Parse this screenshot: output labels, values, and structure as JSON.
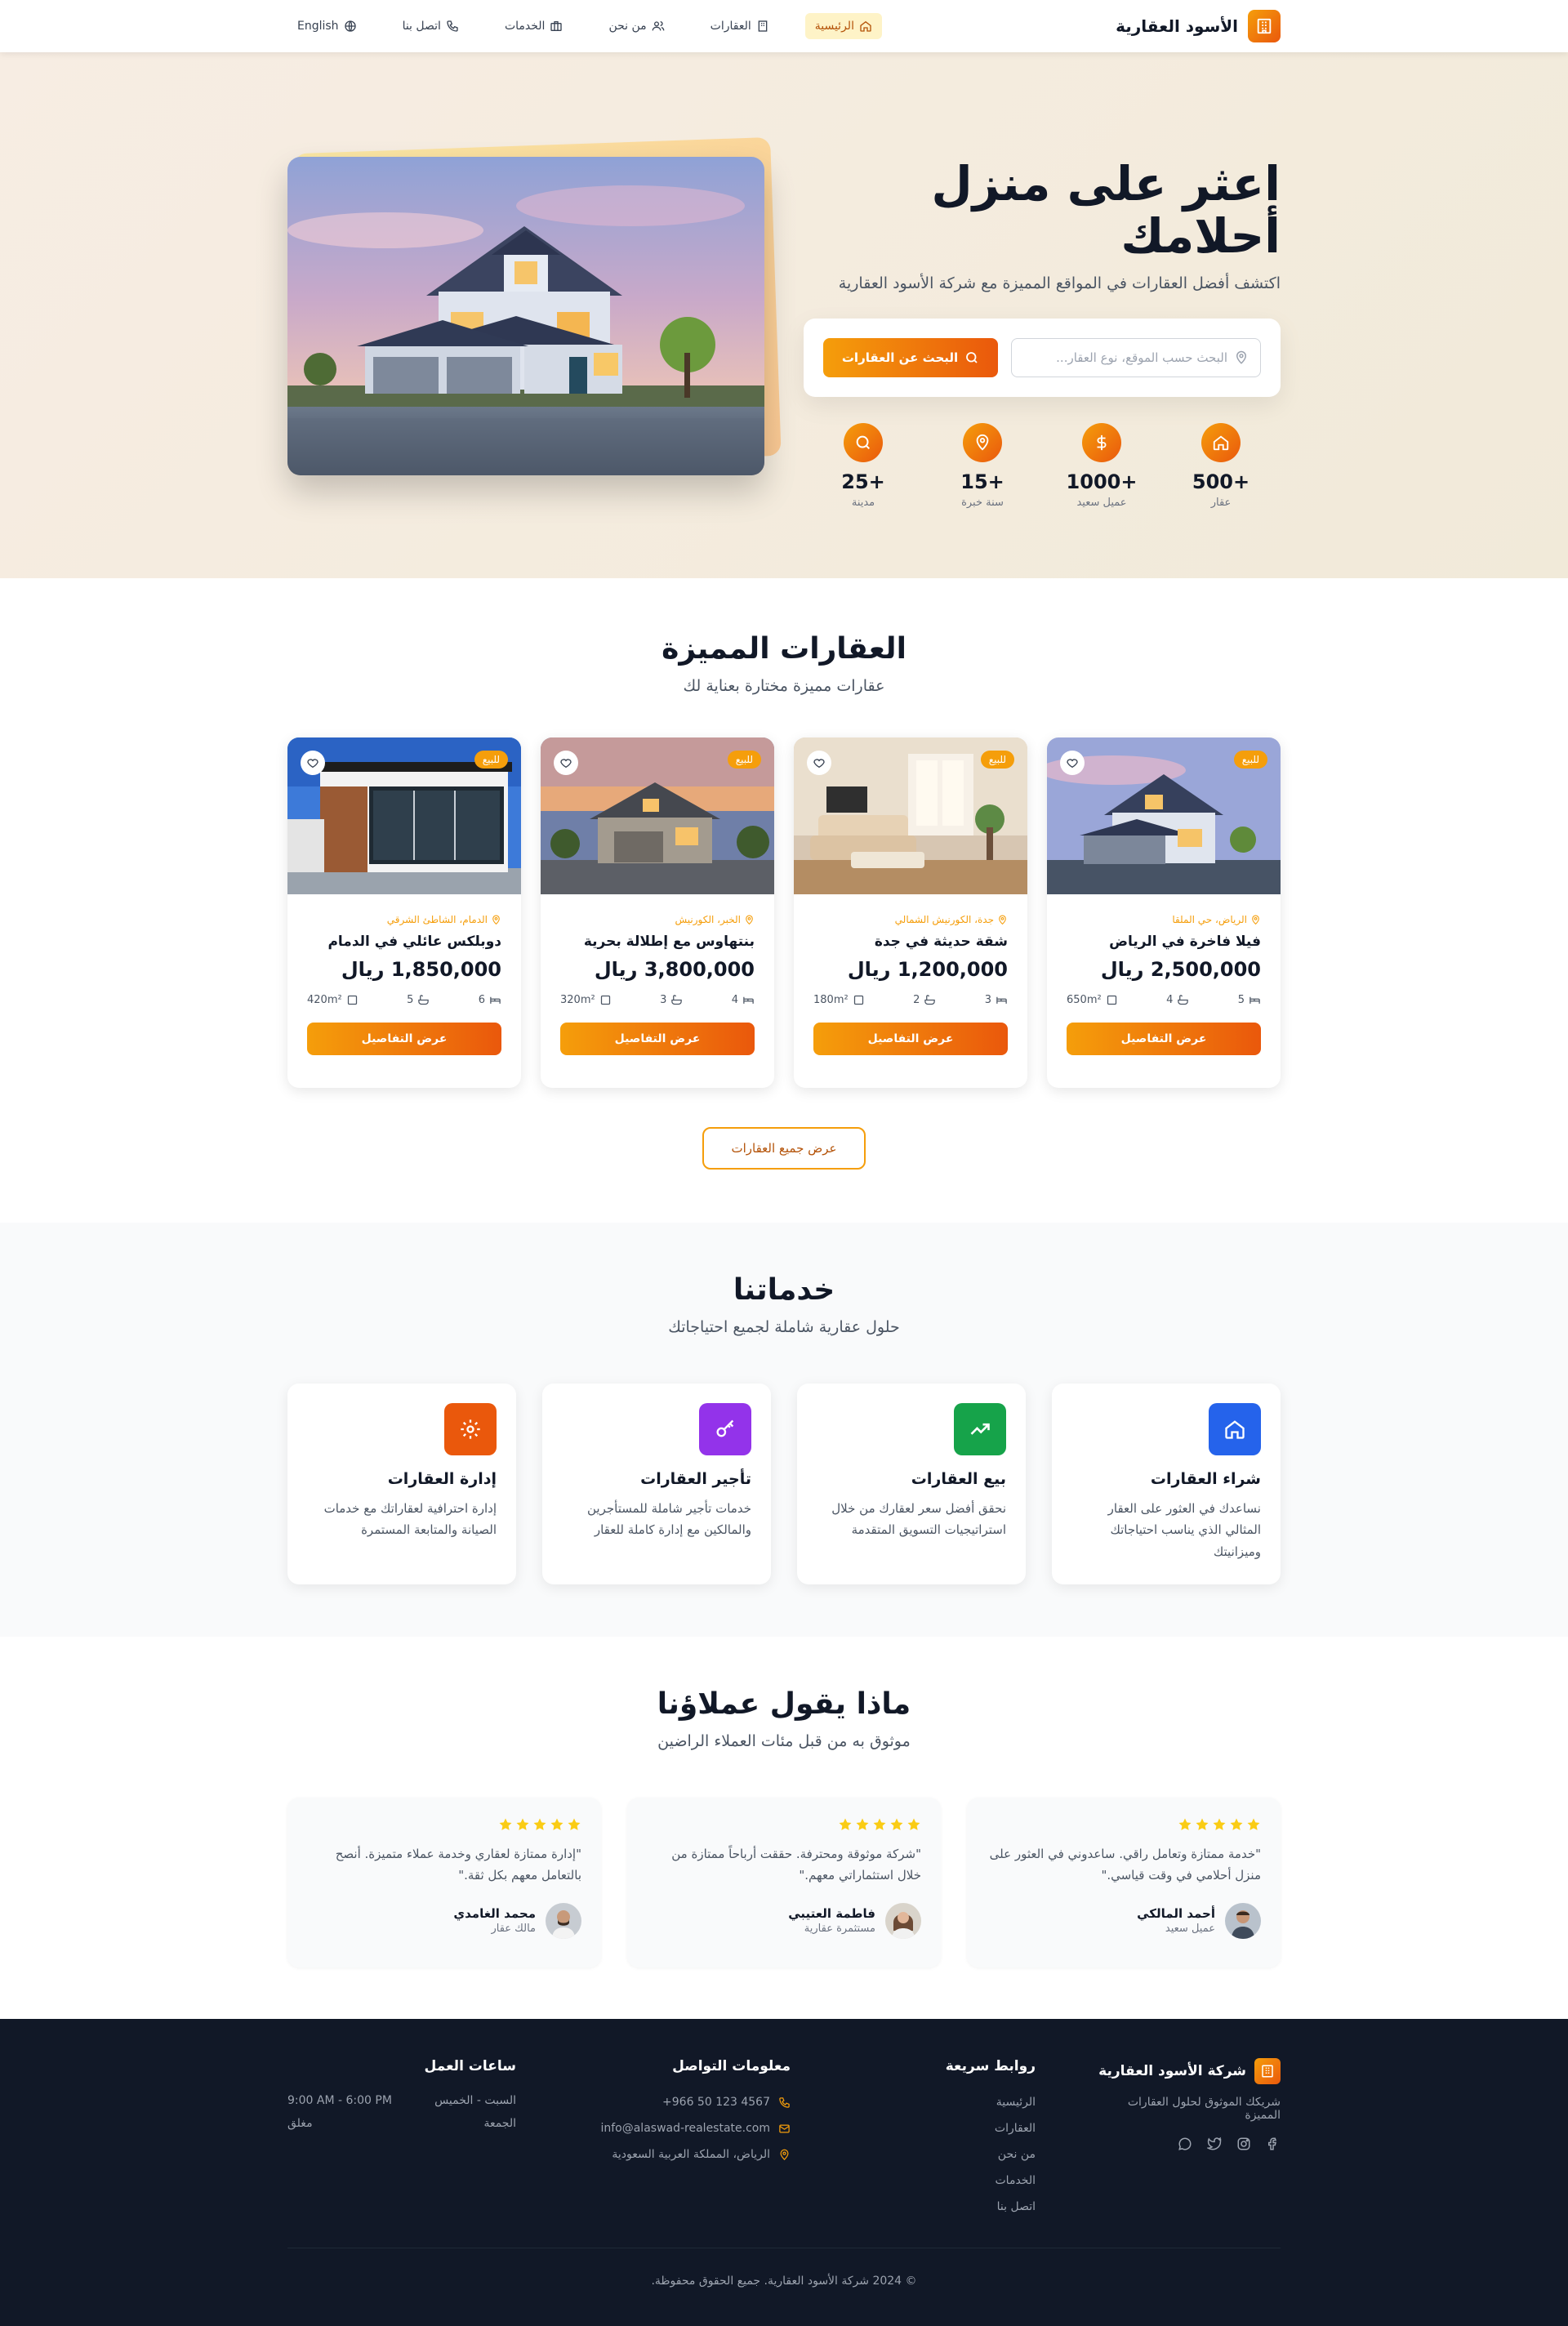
{
  "nav": {
    "brand": "الأسود العقارية",
    "items": [
      {
        "label": "الرئيسية"
      },
      {
        "label": "العقارات"
      },
      {
        "label": "من نحن"
      },
      {
        "label": "الخدمات"
      },
      {
        "label": "اتصل بنا"
      },
      {
        "label": "English"
      }
    ]
  },
  "hero": {
    "title": "اعثر على منزل أحلامك",
    "subtitle": "اكتشف أفضل العقارات في المواقع المميزة مع شركة الأسود العقارية",
    "search_placeholder": "البحث حسب الموقع، نوع العقار...",
    "search_button": "البحث عن العقارات",
    "stats": [
      {
        "num": "500+",
        "label": "عقار",
        "icon": "home-icon"
      },
      {
        "num": "1000+",
        "label": "عميل سعيد",
        "icon": "dollar-icon"
      },
      {
        "num": "15+",
        "label": "سنة خبرة",
        "icon": "map-pin-icon"
      },
      {
        "num": "25+",
        "label": "مدينة",
        "icon": "search-icon"
      }
    ]
  },
  "featured": {
    "title": "العقارات المميزة",
    "subtitle": "عقارات مميزة مختارة بعناية لك",
    "badge": "للبيع",
    "details_button": "عرض التفاصيل",
    "all_button": "عرض جميع العقارات",
    "properties": [
      {
        "location": "الرياض، حي الملقا",
        "title": "فيلا فاخرة في الرياض",
        "price": "2,500,000 ريال",
        "beds": "5",
        "baths": "4",
        "area": "650m²"
      },
      {
        "location": "جدة، الكورنيش الشمالي",
        "title": "شقة حديثة في جدة",
        "price": "1,200,000 ريال",
        "beds": "3",
        "baths": "2",
        "area": "180m²"
      },
      {
        "location": "الخبر، الكورنيش",
        "title": "بنتهاوس مع إطلالة بحرية",
        "price": "3,800,000 ريال",
        "beds": "4",
        "baths": "3",
        "area": "320m²"
      },
      {
        "location": "الدمام، الشاطئ الشرقي",
        "title": "دوبلكس عائلي في الدمام",
        "price": "1,850,000 ريال",
        "beds": "6",
        "baths": "5",
        "area": "420m²"
      }
    ]
  },
  "services": {
    "title": "خدماتنا",
    "subtitle": "حلول عقارية شاملة لجميع احتياجاتك",
    "items": [
      {
        "title": "شراء العقارات",
        "desc": "نساعدك في العثور على العقار المثالي الذي يناسب احتياجاتك وميزانيتك",
        "color": "#2563eb",
        "icon": "home-icon"
      },
      {
        "title": "بيع العقارات",
        "desc": "نحقق أفضل سعر لعقارك من خلال استراتيجيات التسويق المتقدمة",
        "color": "#16a34a",
        "icon": "trending-up-icon"
      },
      {
        "title": "تأجير العقارات",
        "desc": "خدمات تأجير شاملة للمستأجرين والمالكين مع إدارة كاملة للعقار",
        "color": "#9333ea",
        "icon": "key-icon"
      },
      {
        "title": "إدارة العقارات",
        "desc": "إدارة احترافية لعقاراتك مع خدمات الصيانة والمتابعة المستمرة",
        "color": "#ea580c",
        "icon": "gear-icon"
      }
    ]
  },
  "testimonials": {
    "title": "ماذا يقول عملاؤنا",
    "subtitle": "موثوق به من قبل مئات العملاء الراضين",
    "items": [
      {
        "quote": "\"خدمة ممتازة وتعامل راقي. ساعدوني في العثور على منزل أحلامي في وقت قياسي.\"",
        "name": "أحمد المالكي",
        "role": "عميل سعيد"
      },
      {
        "quote": "\"شركة موثوقة ومحترفة. حققت أرباحاً ممتازة من خلال استثماراتي معهم.\"",
        "name": "فاطمة العتيبي",
        "role": "مستثمرة عقارية"
      },
      {
        "quote": "\"إدارة ممتازة لعقاري وخدمة عملاء متميزة. أنصح بالتعامل معهم بكل ثقة.\"",
        "name": "محمد الغامدي",
        "role": "مالك عقار"
      }
    ]
  },
  "footer": {
    "brand": "شركة الأسود العقارية",
    "tagline": "شريكك الموثوق لحلول العقارات المميزة",
    "quick_links_title": "روابط سريعة",
    "quick_links": [
      "الرئيسية",
      "العقارات",
      "من نحن",
      "الخدمات",
      "اتصل بنا"
    ],
    "contact_title": "معلومات التواصل",
    "phone": "+966 50 123 4567",
    "email": "info@alaswad-realestate.com",
    "address": "الرياض، المملكة العربية السعودية",
    "hours_title": "ساعات العمل",
    "hours": [
      {
        "day": "السبت - الخميس",
        "time": "9:00 AM - 6:00 PM"
      },
      {
        "day": "الجمعة",
        "time": "مغلق"
      }
    ],
    "copyright": "© 2024 شركة الأسود العقارية. جميع الحقوق محفوظة."
  },
  "colors": {
    "accent": "#f59e0b",
    "accent_dark": "#ea580c",
    "dark": "#111827"
  }
}
